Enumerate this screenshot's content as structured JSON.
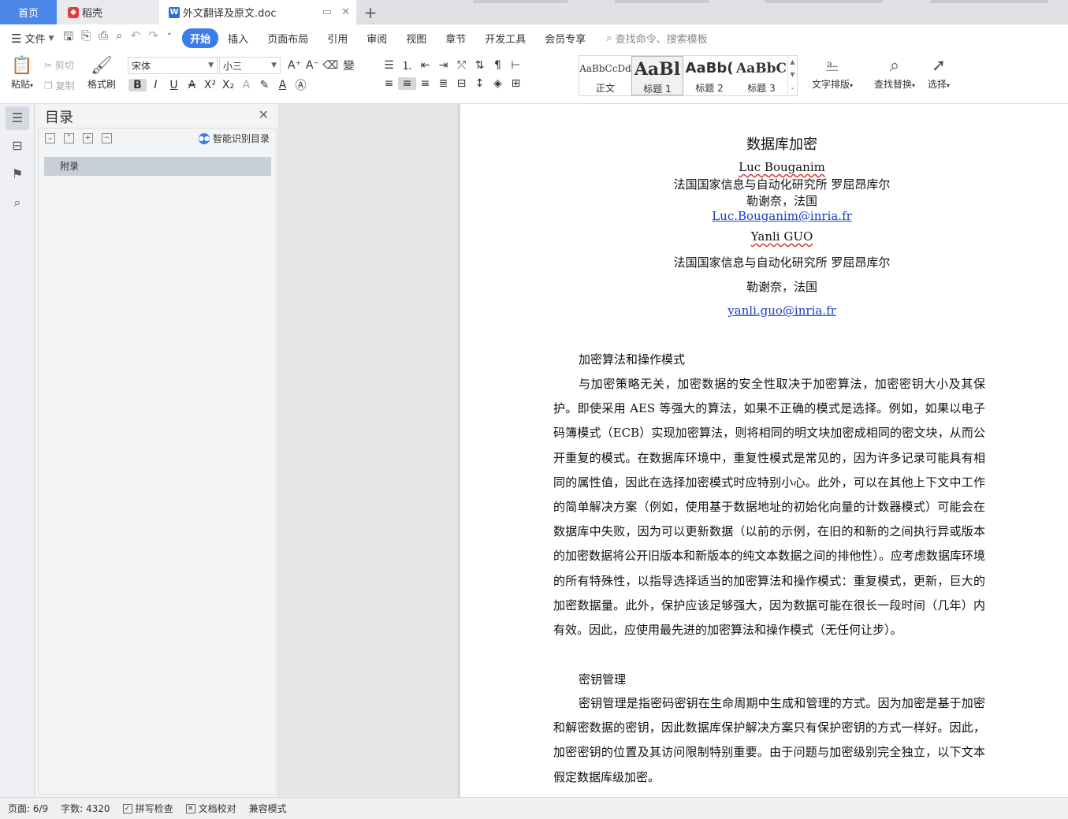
{
  "tabs": {
    "home": "首页",
    "daoke": "稻壳",
    "doc": "外文翻译及原文.doc",
    "new_tab": "+"
  },
  "menubar": {
    "file": "文件",
    "items": [
      "开始",
      "插入",
      "页面布局",
      "引用",
      "审阅",
      "视图",
      "章节",
      "开发工具",
      "会员专享"
    ],
    "search_placeholder": "查找命令、搜索模板"
  },
  "ribbon": {
    "paste": "粘贴",
    "cut": "剪切",
    "copy": "复制",
    "format_painter": "格式刷",
    "font_name": "宋体",
    "font_size": "小三",
    "styles": [
      {
        "preview": "AaBbCcDd",
        "label": "正文"
      },
      {
        "preview": "AaBl",
        "label": "标题 1"
      },
      {
        "preview": "AaBb(",
        "label": "标题 2"
      },
      {
        "preview": "AaBbC",
        "label": "标题 3"
      }
    ],
    "text_layout": "文字排版",
    "find_replace": "查找替换",
    "select": "选择"
  },
  "toc": {
    "title": "目录",
    "smart": "智能识别目录",
    "entries": [
      "附录"
    ]
  },
  "document": {
    "title": "数据库加密",
    "author1": "Luc Bouganim",
    "affil1": "法国国家信息与自动化研究所  罗屈昂库尔",
    "city1": "勒谢奈，法国",
    "email1": "Luc.Bouganim@inria.fr",
    "author2": "Yanli GUO",
    "affil2": "法国国家信息与自动化研究所  罗屈昂库尔",
    "city2": "勒谢奈，法国",
    "email2": "yanli.guo@inria.fr",
    "heading1": "加密算法和操作模式",
    "para1": "与加密策略无关，加密数据的安全性取决于加密算法，加密密钥大小及其保护。即使采用 AES 等强大的算法，如果不正确的模式是选择。例如，如果以电子码簿模式（ECB）实现加密算法，则将相同的明文块加密成相同的密文块，从而公开重复的模式。在数据库环境中，重复性模式是常见的，因为许多记录可能具有相同的属性值，因此在选择加密模式时应特别小心。此外，可以在其他上下文中工作的简单解决方案（例如，使用基于数据地址的初始化向量的计数器模式）可能会在数据库中失败，因为可以更新数据（以前的示例，在旧的和新的之间执行异或版本的加密数据将公开旧版本和新版本的纯文本数据之间的排他性）。应考虑数据库环境的所有特殊性，以指导选择适当的加密算法和操作模式：重复模式，更新，巨大的加密数据量。此外，保护应该足够强大，因为数据可能在很长一段时间（几年）内有效。因此，应使用最先进的加密算法和操作模式（无任何让步）。",
    "heading2": "密钥管理",
    "para2": "密钥管理是指密码密钥在生命周期中生成和管理的方式。因为加密是基于加密和解密数据的密钥，因此数据库保护解决方案只有保护密钥的方式一样好。因此，加密密钥的位置及其访问限制特别重要。由于问题与加密级别完全独立，以下文本假定数据库级加密。"
  },
  "statusbar": {
    "page": "页面: 6/9",
    "words": "字数: 4320",
    "spell": "拼写检查",
    "proof": "文档校对",
    "compat": "兼容模式"
  },
  "colors": {
    "accent": "#3b7de9",
    "home_tab": "#4a87e8",
    "link": "#1a3cc9"
  }
}
